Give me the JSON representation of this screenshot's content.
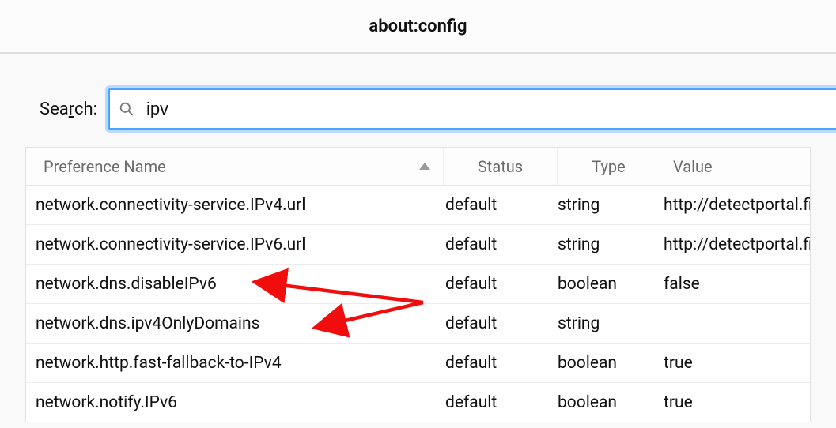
{
  "title": "about:config",
  "search": {
    "label_pre": "Sea",
    "label_underline": "r",
    "label_post": "ch:",
    "value": "ipv",
    "placeholder": ""
  },
  "columns": {
    "name": "Preference Name",
    "status": "Status",
    "type": "Type",
    "value": "Value"
  },
  "rows": [
    {
      "name": "network.connectivity-service.IPv4.url",
      "status": "default",
      "type": "string",
      "value": "http://detectportal.fir"
    },
    {
      "name": "network.connectivity-service.IPv6.url",
      "status": "default",
      "type": "string",
      "value": "http://detectportal.fir"
    },
    {
      "name": "network.dns.disableIPv6",
      "status": "default",
      "type": "boolean",
      "value": "false"
    },
    {
      "name": "network.dns.ipv4OnlyDomains",
      "status": "default",
      "type": "string",
      "value": ""
    },
    {
      "name": "network.http.fast-fallback-to-IPv4",
      "status": "default",
      "type": "boolean",
      "value": "true"
    },
    {
      "name": "network.notify.IPv6",
      "status": "default",
      "type": "boolean",
      "value": "true"
    }
  ]
}
